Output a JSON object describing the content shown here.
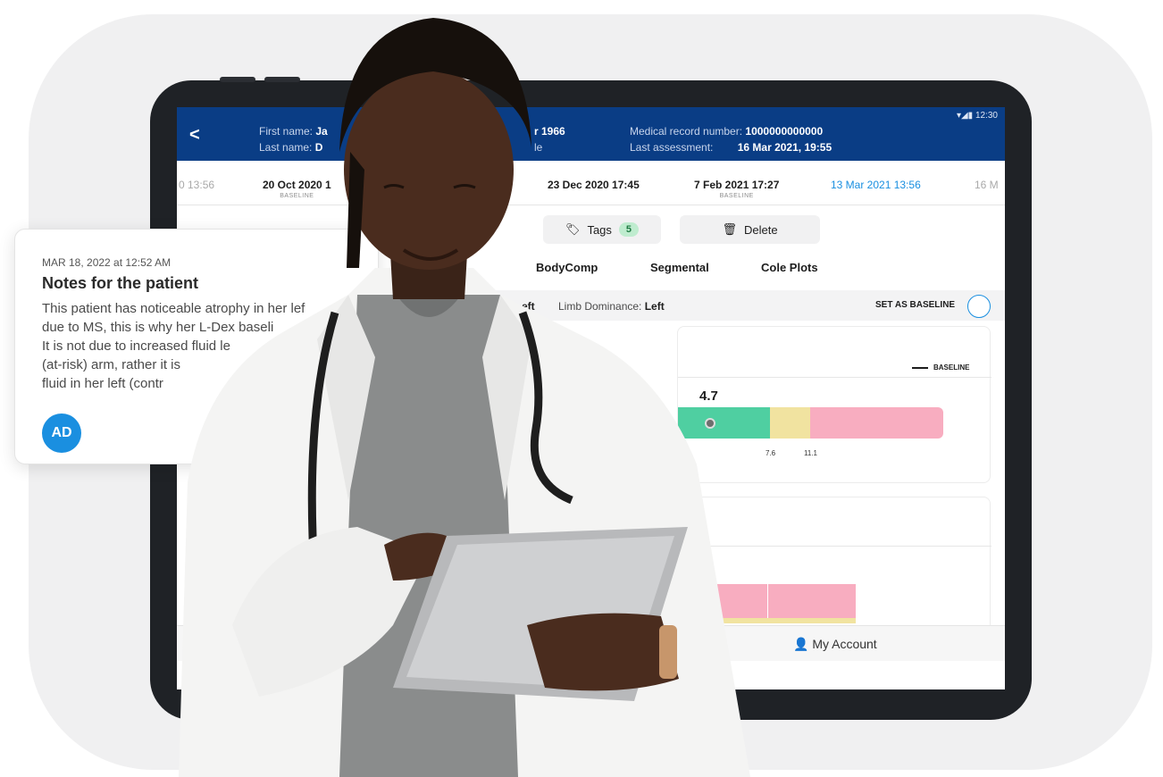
{
  "header": {
    "first_name_label": "First name:",
    "first_name_value": "Ja",
    "last_name_label": "Last name:",
    "last_name_value": "D",
    "dob_fragment": "r 1966",
    "sex_fragment": "le",
    "mrn_label": "Medical record number:",
    "mrn_value": "1000000000000",
    "last_assessment_label": "Last assessment:",
    "last_assessment_value": "16 Mar 2021, 19:55",
    "status_time": "12:30",
    "back_glyph": "<"
  },
  "dates": [
    {
      "label": "0 13:56",
      "sub": ""
    },
    {
      "label": "20 Oct 2020 1",
      "sub": "BASELINE"
    },
    {
      "label": "23 Dec 2020 17:45",
      "sub": ""
    },
    {
      "label": "7 Feb 2021 17:27",
      "sub": "BASELINE"
    },
    {
      "label": "13 Mar 2021 13:56",
      "sub": ""
    },
    {
      "label": "16 M",
      "sub": ""
    }
  ],
  "actions": {
    "tags_label": "Tags",
    "tags_count": "5",
    "delete_label": "Delete"
  },
  "tabs": [
    "BodyComp",
    "Segmental",
    "Cole Plots"
  ],
  "info_bar": {
    "left_fragment": "eft",
    "limb_dominance_label": "Limb Dominance:",
    "limb_dominance_value": "Left",
    "set_baseline_label": "SET AS BASELINE"
  },
  "ldex_card": {
    "legend": "BASELINE",
    "value": "4.7",
    "ticks": [
      "7.6",
      "11.1"
    ]
  },
  "nav": {
    "account_label": "My Account"
  },
  "note": {
    "timestamp": "MAR 18, 2022 at 12:52 AM",
    "title": "Notes for the patient",
    "lines": [
      "This patient has noticeable atrophy in her lef",
      "due to MS, this is why her L-Dex baseli",
      "It is not due to increased fluid le",
      "(at-risk) arm, rather it is",
      "fluid in her left (contr"
    ],
    "avatar_initials": "AD"
  },
  "colors": {
    "appbar": "#0a3d85",
    "accent": "#1a8fe0",
    "green": "#4fcfa1",
    "yellow": "#f1e3a0",
    "pink": "#f8adc0"
  }
}
